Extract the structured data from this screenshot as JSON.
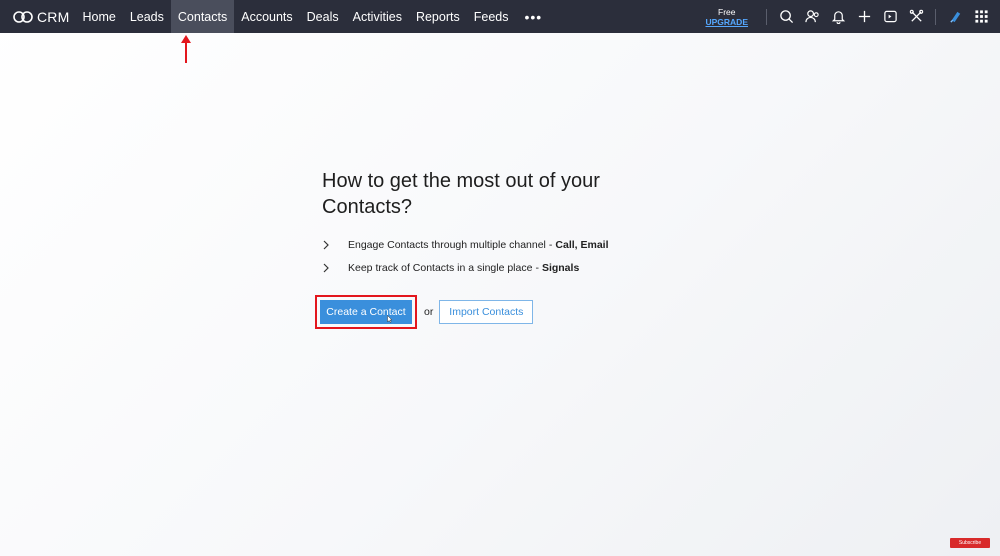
{
  "app": {
    "brand_name": "CRM",
    "brand_icon": "zoho-logo-icon"
  },
  "nav": {
    "items": [
      {
        "label": "Home"
      },
      {
        "label": "Leads"
      },
      {
        "label": "Contacts",
        "active": true
      },
      {
        "label": "Accounts"
      },
      {
        "label": "Deals"
      },
      {
        "label": "Activities"
      },
      {
        "label": "Reports"
      },
      {
        "label": "Feeds"
      }
    ],
    "more_label": "•••"
  },
  "plan": {
    "label": "Free",
    "upgrade_label": "UPGRADE"
  },
  "toolbar_icons": [
    "search-icon",
    "contacts-icon",
    "bell-icon",
    "plus-icon",
    "calendar-icon",
    "tools-icon",
    "feather-icon",
    "apps-grid-icon"
  ],
  "main": {
    "heading": "How to get the most out of your Contacts?",
    "tips": [
      {
        "text": "Engage Contacts through multiple channel",
        "separator": "-",
        "strong": "Call, Email"
      },
      {
        "text": "Keep track of Contacts in a single place",
        "separator": "-",
        "strong": "Signals"
      }
    ],
    "create_button": "Create a Contact",
    "or_text": "or",
    "import_button": "Import Contacts"
  },
  "badge": {
    "text": "Subscribe"
  },
  "colors": {
    "topbar": "#2b2e3b",
    "active_tab": "#4a4e5c",
    "primary": "#3a8fdc",
    "highlight": "#e3161d",
    "upgrade_link": "#56a8ff"
  }
}
